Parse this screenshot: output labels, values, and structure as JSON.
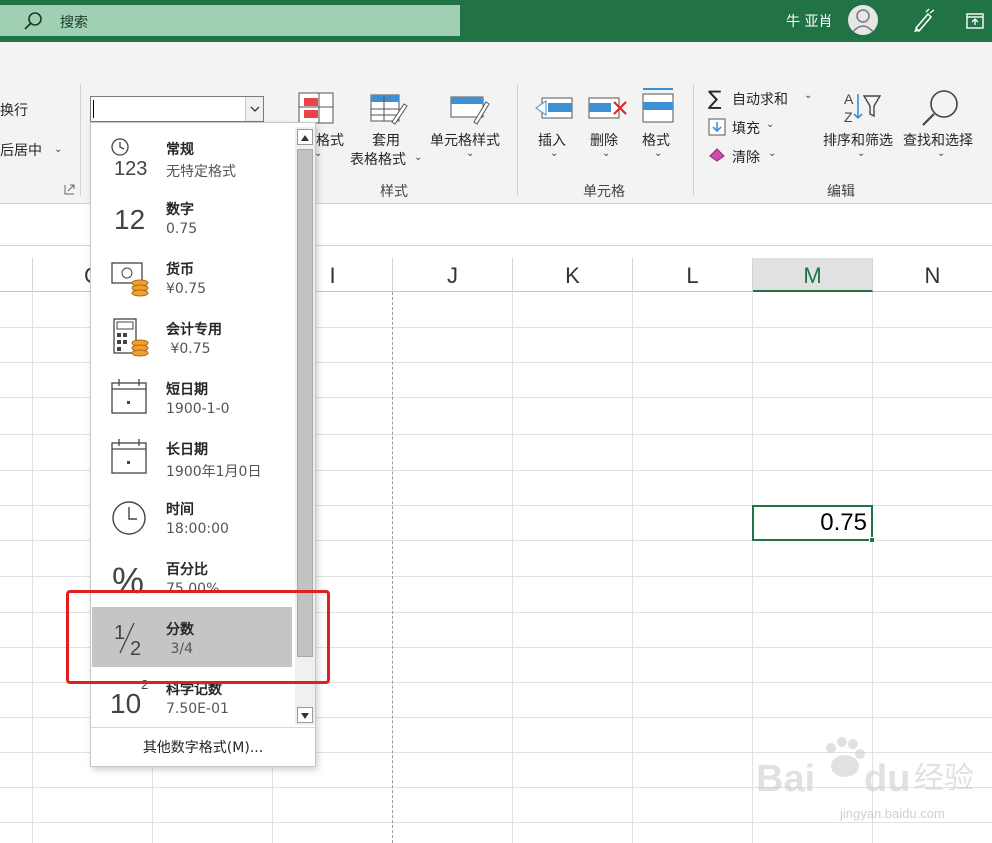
{
  "titlebar": {
    "search_label": "搜索",
    "user_name": "牛 亚肖",
    "accent": "#217346"
  },
  "ribbon": {
    "wrap_text_partial": "换行",
    "merge_center_partial": "后居中",
    "cond_format_partial": "格式",
    "table_format_line1": "套用",
    "table_format_line2": "表格格式",
    "cell_styles": "单元格样式",
    "styles_group": "样式",
    "insert": "插入",
    "delete": "删除",
    "format": "格式",
    "cells_group": "单元格",
    "autosum": "自动求和",
    "fill": "填充",
    "clear": "清除",
    "sort_filter": "排序和筛选",
    "find_select": "查找和选择",
    "editing_group": "编辑",
    "format_combo_value": ""
  },
  "columns": [
    "G",
    "I",
    "J",
    "K",
    "L",
    "M",
    "N"
  ],
  "active_column": "M",
  "selected_cell": {
    "value": "0.75"
  },
  "number_formats": [
    {
      "name": "常规",
      "sample": "无特定格式",
      "icon": "general-123-icon"
    },
    {
      "name": "数字",
      "sample": "0.75",
      "icon": "number-12-icon"
    },
    {
      "name": "货币",
      "sample": "¥0.75",
      "icon": "currency-icon"
    },
    {
      "name": "会计专用",
      "sample": " ¥0.75",
      "icon": "accounting-icon"
    },
    {
      "name": "短日期",
      "sample": "1900-1-0",
      "icon": "calendar-icon"
    },
    {
      "name": "长日期",
      "sample": "1900年1月0日",
      "icon": "calendar-icon"
    },
    {
      "name": "时间",
      "sample": "18:00:00",
      "icon": "clock-icon"
    },
    {
      "name": "百分比",
      "sample": "75.00%",
      "icon": "percent-icon"
    },
    {
      "name": "分数",
      "sample": " 3/4",
      "icon": "fraction-icon"
    },
    {
      "name": "科学记数",
      "sample": "7.50E-01",
      "icon": "scientific-icon"
    }
  ],
  "selected_format_index": 8,
  "more_formats": "其他数字格式(M)...",
  "watermark": {
    "brand": "Baidu经验",
    "url": "jingyan.baidu.com"
  }
}
